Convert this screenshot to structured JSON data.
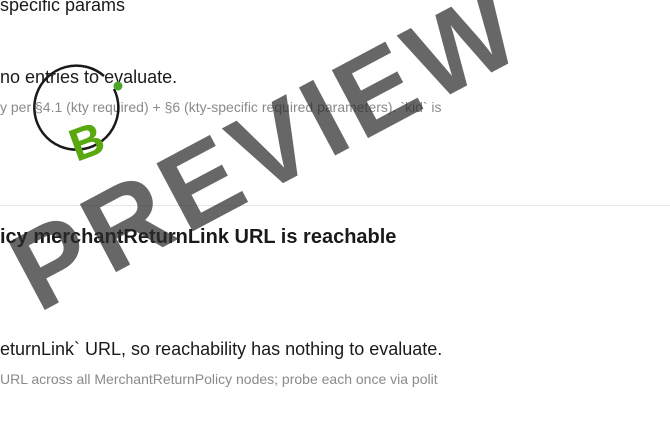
{
  "check1": {
    "params_line": "specific params",
    "result": "no entries to evaluate.",
    "note": "y per §4.1 (kty required) + §6 (kty-specific required parameters). `kid` is"
  },
  "check2": {
    "title": "icy merchantReturnLink URL is reachable",
    "result": "eturnLink` URL, so reachability has nothing to evaluate.",
    "note": "URL across all MerchantReturnPolicy nodes; probe each once via polit"
  },
  "badge": {
    "letter": "B",
    "ring_color": "#1a1a1a",
    "letter_color": "#5aa80f",
    "dot_color": "#4aa52a"
  },
  "watermark": "PREVIEW"
}
